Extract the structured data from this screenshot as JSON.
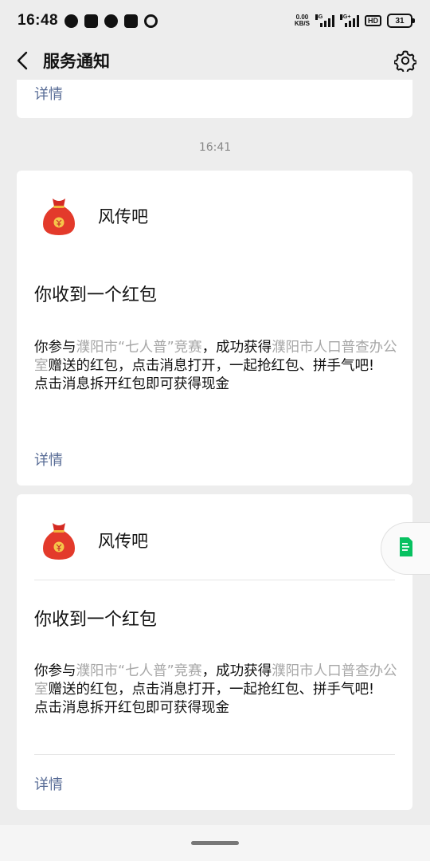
{
  "status_bar": {
    "time": "16:48",
    "net_speed_value": "0.00",
    "net_speed_unit": "KB/S",
    "sig1_tag": "4G",
    "sig2_tag": "4G+",
    "hd_tag": "HD",
    "battery": "31"
  },
  "navbar": {
    "title": "服务通知"
  },
  "top_card": {
    "detail_label": "详情"
  },
  "timestamp": "16:41",
  "messages": [
    {
      "sender": "风传吧",
      "title": "你收到一个红包",
      "body": {
        "prefix": "你参与",
        "highlight1": "濮阳市“七人普”竞赛",
        "middle": "，成功获得",
        "highlight2": "濮阳市人口普查办公室",
        "suffix": "赠送的红包，点击消息打开，一起抢红包、拼手气吧!",
        "line2": "点击消息拆开红包即可获得现金"
      },
      "detail_label": "详情"
    },
    {
      "sender": "风传吧",
      "title": "你收到一个红包",
      "body": {
        "prefix": "你参与",
        "highlight1": "濮阳市“七人普”竞赛",
        "middle": "，成功获得",
        "highlight2": "濮阳市人口普查办公室",
        "suffix": "赠送的红包，点击消息打开，一起抢红包、拼手气吧!",
        "line2": "点击消息拆开红包即可获得现金"
      },
      "detail_label": "详情"
    }
  ],
  "icons": {
    "back": "back-chevron-icon",
    "settings": "gear-icon",
    "avatar": "red-money-bag-icon",
    "float": "document-icon"
  },
  "colors": {
    "link": "#576b95",
    "highlight": "#a7a7a7",
    "background": "#ededed",
    "float_icon": "#07c160"
  }
}
